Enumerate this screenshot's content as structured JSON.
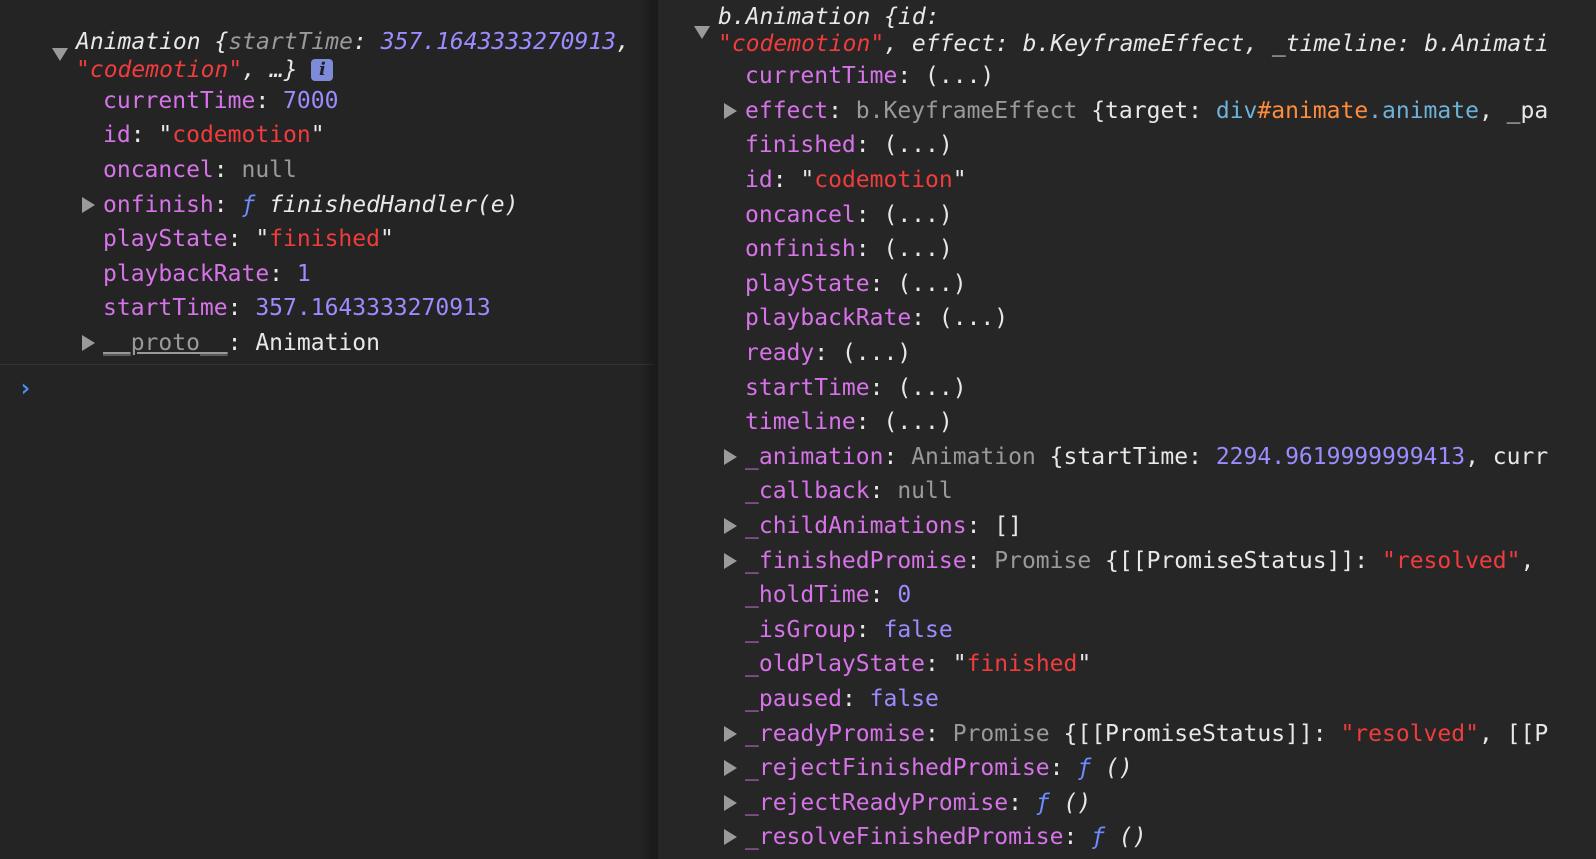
{
  "left": {
    "header_line1_prefix": "Animation {",
    "header_line1_key": "startTime",
    "header_line1_sep": ": ",
    "header_line1_value": "357.1643333270913",
    "header_line1_comma": ",",
    "header_line2_value": "\"codemotion\"",
    "header_line2_suffix": ", …}",
    "info_label": "i",
    "props": [
      {
        "key": "currentTime",
        "value": "7000"
      },
      {
        "key": "id",
        "q1": "\"",
        "value": "codemotion",
        "q2": "\""
      },
      {
        "key": "oncancel",
        "value": "null"
      },
      {
        "key": "onfinish",
        "f": "ƒ",
        "value": "finishedHandler(e)"
      },
      {
        "key": "playState",
        "q1": "\"",
        "value": "finished",
        "q2": "\""
      },
      {
        "key": "playbackRate",
        "value": "1"
      },
      {
        "key": "startTime",
        "value": "357.1643333270913"
      },
      {
        "key": "__proto__",
        "value": "Animation"
      }
    ],
    "colon": ": ",
    "prompt": "›"
  },
  "right": {
    "header_line1": "b.Animation {id:",
    "header_line2_str": "\"codemotion\"",
    "header_line2_rest1": ", effect: ",
    "header_line2_type": "b.KeyframeEffect",
    "header_line2_rest2": ", _timeline: ",
    "header_line2_type2": "b.Animati",
    "rows": [
      {
        "key": "currentTime",
        "colon": ": ",
        "value": "(...)"
      },
      {
        "key": "effect",
        "colon": ": ",
        "type": "b.KeyframeEffect",
        "brace": " {target: ",
        "tag": "div",
        "hash": "#animate",
        "cls": ".animate",
        "tail": ", _pa"
      },
      {
        "key": "finished",
        "colon": ": ",
        "value": "(...)"
      },
      {
        "key": "id",
        "colon": ": ",
        "q1": "\"",
        "value": "codemotion",
        "q2": "\""
      },
      {
        "key": "oncancel",
        "colon": ": ",
        "value": "(...)"
      },
      {
        "key": "onfinish",
        "colon": ": ",
        "value": "(...)"
      },
      {
        "key": "playState",
        "colon": ": ",
        "value": "(...)"
      },
      {
        "key": "playbackRate",
        "colon": ": ",
        "value": "(...)"
      },
      {
        "key": "ready",
        "colon": ": ",
        "value": "(...)"
      },
      {
        "key": "startTime",
        "colon": ": ",
        "value": "(...)"
      },
      {
        "key": "timeline",
        "colon": ": ",
        "value": "(...)"
      },
      {
        "key": "_animation",
        "colon": ": ",
        "type": "Animation",
        "brace": " {startTime: ",
        "num": "2294.9619999999413",
        "tail": ", curr"
      },
      {
        "key": "_callback",
        "colon": ": ",
        "value": "null"
      },
      {
        "key": "_childAnimations",
        "colon": ": ",
        "value": "[]"
      },
      {
        "key": "_finishedPromise",
        "colon": ": ",
        "type": "Promise",
        "brace": " {[[PromiseStatus]]: ",
        "str": "\"resolved\"",
        "tail": ","
      },
      {
        "key": "_holdTime",
        "colon": ": ",
        "value": "0"
      },
      {
        "key": "_isGroup",
        "colon": ": ",
        "value": "false"
      },
      {
        "key": "_oldPlayState",
        "colon": ": ",
        "q1": "\"",
        "value": "finished",
        "q2": "\""
      },
      {
        "key": "_paused",
        "colon": ": ",
        "value": "false"
      },
      {
        "key": "_readyPromise",
        "colon": ": ",
        "type": "Promise",
        "brace": " {[[PromiseStatus]]: ",
        "str": "\"resolved\"",
        "tail": ", [[P"
      },
      {
        "key": "_rejectFinishedPromise",
        "colon": ": ",
        "f": "ƒ",
        "value": "()"
      },
      {
        "key": "_rejectReadyPromise",
        "colon": ": ",
        "f": "ƒ",
        "value": "()"
      },
      {
        "key": "_resolveFinishedPromise",
        "colon": ": ",
        "f": "ƒ",
        "value": "()"
      }
    ]
  },
  "colors": {
    "key": "#d773e8",
    "number": "#9b8cff",
    "string": "#f03c3c",
    "gray": "#9a9a9a",
    "prompt": "#4d8cf0"
  }
}
